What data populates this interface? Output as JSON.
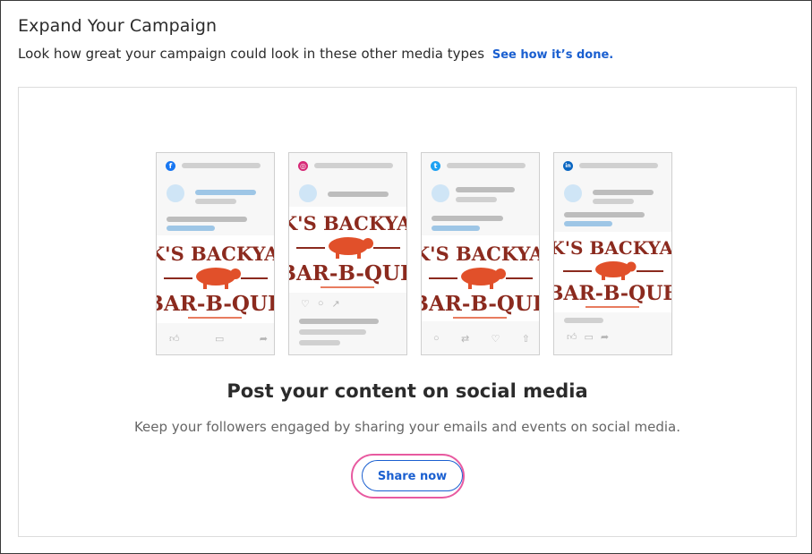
{
  "header": {
    "title": "Expand Your Campaign",
    "subtitle": "Look how great your campaign could look in these other media types",
    "link": "See how it’s done."
  },
  "preview": {
    "brand_line1": "ACK'S BACKYARD",
    "brand_line2": "BAR-B-QUE",
    "cards": [
      {
        "network": "facebook",
        "icon": "facebook-icon",
        "color": "#1877f2",
        "glyph": "f"
      },
      {
        "network": "instagram",
        "icon": "instagram-icon",
        "color": "#d62976",
        "glyph": "◎"
      },
      {
        "network": "twitter",
        "icon": "twitter-icon",
        "color": "#1da1f2",
        "glyph": "t"
      },
      {
        "network": "linkedin",
        "icon": "linkedin-icon",
        "color": "#0a66c2",
        "glyph": "in"
      }
    ]
  },
  "main": {
    "heading": "Post your content on social media",
    "description": "Keep your followers engaged by sharing your emails and events on social media.",
    "share_label": "Share now"
  },
  "colors": {
    "accent": "#1a5fd0",
    "highlight": "#e85aa0",
    "brand_red": "#8b2a1e",
    "pig": "#e1502a"
  }
}
